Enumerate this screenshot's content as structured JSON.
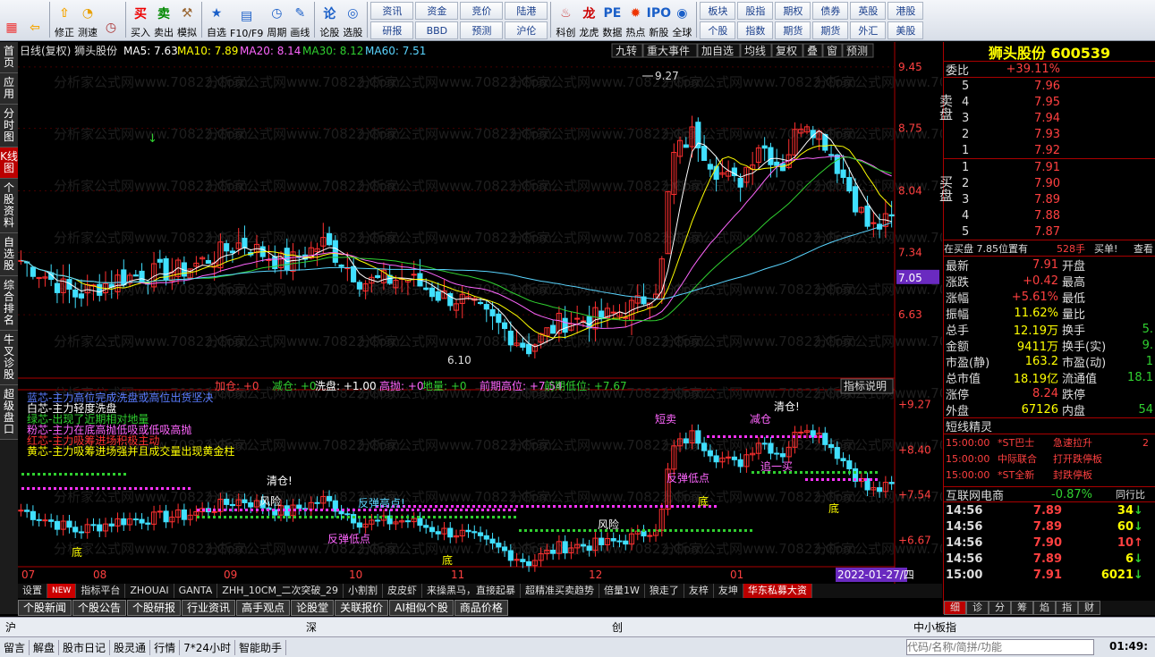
{
  "toolbar": {
    "items": [
      {
        "label": "",
        "icon": "grid-icon"
      },
      {
        "label": "",
        "icon": "back-arrow-icon"
      },
      {
        "label": "修正",
        "icon": "up-arrow-icon"
      },
      {
        "label": "测速",
        "icon": "speed-icon"
      },
      {
        "label": "",
        "icon": "clock-icon"
      },
      {
        "label": "买入",
        "icon": "buy-icon"
      },
      {
        "label": "卖出",
        "icon": "sell-icon"
      },
      {
        "label": "模拟",
        "icon": "hammer-icon"
      },
      {
        "label": "自选",
        "icon": "star-icon"
      },
      {
        "label": "F10/F9",
        "icon": "f10-icon"
      },
      {
        "label": "周期",
        "icon": "cycle-icon"
      },
      {
        "label": "画线",
        "icon": "pen-icon"
      },
      {
        "label": "论股",
        "icon": "chat-icon"
      },
      {
        "label": "选股",
        "icon": "select-icon"
      }
    ],
    "grid1": [
      "资讯",
      "资金",
      "竞价",
      "研报",
      "BBD",
      "预测"
    ],
    "grid2": [
      "陆港",
      "沪伦"
    ],
    "icons2": [
      {
        "label": "科创",
        "icon": "kc-icon"
      },
      {
        "label": "龙虎",
        "icon": "dragon-icon"
      },
      {
        "label": "数据",
        "icon": "pe-icon"
      },
      {
        "label": "热点",
        "icon": "hot-icon"
      },
      {
        "label": "新股",
        "icon": "ipo-icon"
      },
      {
        "label": "全球",
        "icon": "globe-icon"
      }
    ],
    "grid3": [
      "板块",
      "股指",
      "期权",
      "债券",
      "英股",
      "港股",
      "个股",
      "指数",
      "期货",
      "期货",
      "外汇",
      "美股"
    ]
  },
  "left_tabs": [
    "首页",
    "应用",
    "分时图",
    "K线图",
    "个股资料",
    "自选股",
    "综合排名",
    "牛叉诊股",
    "超级盘口"
  ],
  "chart_header": {
    "text": "日线(复权) 狮头股份",
    "ma5": "MA5: 7.63",
    "ma10": "MA10: 7.89",
    "ma20": "MA20: 8.14",
    "ma30": "MA30: 8.12",
    "ma60": "MA60: 7.51"
  },
  "chart_buttons": [
    "九转",
    "重大事件",
    "加自选",
    "均线",
    "复权",
    "叠",
    "窗",
    "预测"
  ],
  "price_axis": [
    "9.45",
    "8.75",
    "8.04",
    "7.34",
    "7.05",
    "6.63"
  ],
  "annotations": {
    "high": "9.27",
    "low": "6.10"
  },
  "indicator_header": {
    "jc": "加仓: +0",
    "jc2": "减仓: +0",
    "xp": "洗盘: +1.00",
    "gp": "高抛: +0",
    "dl": "地量: +0",
    "qh": "前期高位: +7.54",
    "ql": "前期低位: +7.67",
    "btn": "指标说明"
  },
  "indicator_axis": [
    "+9.27",
    "+8.40",
    "+7.54",
    "+6.67"
  ],
  "legend": [
    "蓝芯-主力高位完成洗盘或高位出货坚决",
    "白芯-主力轻度洗盘",
    "绿芯-出现了近期相对地量",
    "粉芯-主力在底高抛低吸或低吸高抛",
    "红芯-主力吸筹进场积极主动",
    "黄芯-主力吸筹进场强并且成交量出现黄金柱"
  ],
  "ind_labels": {
    "qc1": "清仓!",
    "qc2": "清仓!",
    "fx1": "风险",
    "fx2": "风险",
    "ftg": "反弹高点!",
    "ftd": "反弹低点",
    "ftd2": "反弹低点",
    "dp": "短卖",
    "jy": "追一买",
    "d1": "底",
    "d2": "底",
    "d3": "底",
    "d4": "底",
    "cq": "减仓"
  },
  "x_axis": [
    "07",
    "08",
    "09",
    "10",
    "11",
    "12",
    "01"
  ],
  "date_badge": "2022-01-27/四",
  "bottom_tabs": [
    "设置",
    "NEW",
    "指标平台",
    "ZHOUAI",
    "GANTA",
    "ZHH_10CM_二次突破_29",
    "小割割",
    "皮皮虾",
    "来操黑马，直接起暴",
    "超精准买卖趋势",
    "倍量1W",
    "狼走了",
    "友梓",
    "友坤",
    "华东私募大资"
  ],
  "tabs2": [
    "个股新闻",
    "个股公告",
    "个股研报",
    "行业资讯",
    "高手观点",
    "论股堂",
    "关联报价",
    "AI相似个股",
    "商品价格"
  ],
  "status_bar": [
    "沪",
    "深",
    "创",
    "中小板指"
  ],
  "status_bar2": [
    "留言",
    "解盘",
    "股市日记",
    "股灵通",
    "行情",
    "7*24小时",
    "智能助手"
  ],
  "search_placeholder": "代码/名称/简拼/功能",
  "clock": "01:49:",
  "quote": {
    "title": "狮头股份 600539",
    "wb_label": "委比",
    "wb": "+39.11%",
    "sell_label": "卖盘",
    "buy_label": "买盘",
    "sells": [
      {
        "n": "5",
        "p": "7.96"
      },
      {
        "n": "4",
        "p": "7.95"
      },
      {
        "n": "3",
        "p": "7.94"
      },
      {
        "n": "2",
        "p": "7.93"
      },
      {
        "n": "1",
        "p": "7.92"
      }
    ],
    "buys": [
      {
        "n": "1",
        "p": "7.91"
      },
      {
        "n": "2",
        "p": "7.90"
      },
      {
        "n": "3",
        "p": "7.89"
      },
      {
        "n": "4",
        "p": "7.88"
      },
      {
        "n": "5",
        "p": "7.87"
      }
    ],
    "zmp": "在买盘 7.85位置有",
    "zmp_vol": "528手",
    "zmp_act": "买单!",
    "zmp_link": "查看",
    "stats": [
      [
        "最新",
        "7.91",
        "开盘",
        ""
      ],
      [
        "涨跌",
        "+0.42",
        "最高",
        ""
      ],
      [
        "涨幅",
        "+5.61%",
        "最低",
        ""
      ],
      [
        "振幅",
        "11.62%",
        "量比",
        ""
      ],
      [
        "总手",
        "12.19万",
        "换手",
        "5."
      ],
      [
        "金额",
        "9411万",
        "换手(实)",
        "9."
      ],
      [
        "市盈(静)",
        "163.2",
        "市盈(动)",
        "1"
      ],
      [
        "总市值",
        "18.19亿",
        "流通值",
        "18.1"
      ],
      [
        "涨停",
        "8.24",
        "跌停",
        ""
      ],
      [
        "外盘",
        "67126",
        "内盘",
        "54"
      ]
    ],
    "dxjl_title": "短线精灵",
    "dxjl": [
      [
        "15:00:00",
        "*ST巴士",
        "急速拉升",
        "2"
      ],
      [
        "15:00:00",
        "中际联合",
        "打开跌停板",
        ""
      ],
      [
        "15:00:00",
        "*ST全新",
        "封跌停板",
        ""
      ]
    ],
    "sector": "互联网电商",
    "sector_chg": "-0.87%",
    "sector_link": "同行比",
    "ticks": [
      [
        "14:56",
        "7.89",
        "34"
      ],
      [
        "14:56",
        "7.89",
        "60"
      ],
      [
        "14:56",
        "7.90",
        "10"
      ],
      [
        "14:56",
        "7.89",
        "6"
      ],
      [
        "15:00",
        "7.91",
        "6021"
      ]
    ],
    "rp_tabs": [
      "细",
      "诊",
      "分",
      "筹",
      "焰",
      "指",
      "财"
    ]
  }
}
